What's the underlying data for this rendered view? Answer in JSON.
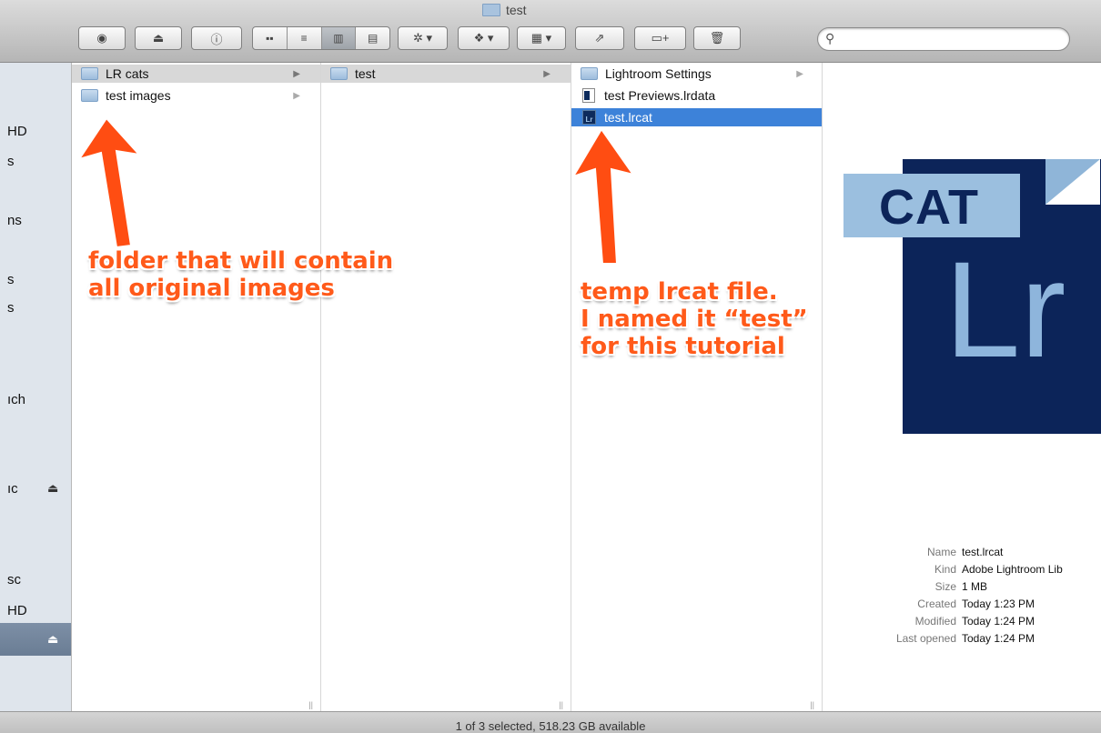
{
  "window": {
    "title": "test"
  },
  "toolbar": {
    "view_buttons": [
      "▪▪",
      "≡",
      "▥",
      "▤"
    ],
    "search": {
      "placeholder": ""
    }
  },
  "sidebar": {
    "items": [
      {
        "label": "HD",
        "eject": false
      },
      {
        "label": "s",
        "eject": false
      },
      {
        "label": "ns",
        "eject": false
      },
      {
        "label": "s",
        "eject": false
      },
      {
        "label": "s",
        "eject": false
      },
      {
        "label": "ıch",
        "eject": false
      },
      {
        "label": "ıc",
        "eject": true
      },
      {
        "label": "sc",
        "eject": false
      },
      {
        "label": "HD",
        "eject": false
      }
    ]
  },
  "columns": [
    {
      "items": [
        {
          "name": "LR cats",
          "icon": "folder-icon",
          "state": "gray",
          "has_children": true
        },
        {
          "name": "test images",
          "icon": "folder-icon",
          "state": "none",
          "has_children": true
        }
      ]
    },
    {
      "items": [
        {
          "name": "test",
          "icon": "folder-icon",
          "state": "gray",
          "has_children": true
        }
      ]
    },
    {
      "items": [
        {
          "name": "Lightroom Settings",
          "icon": "folder-icon",
          "state": "none",
          "has_children": true
        },
        {
          "name": "test Previews.lrdata",
          "icon": "document-icon",
          "state": "none",
          "has_children": false
        },
        {
          "name": "test.lrcat",
          "icon": "lrcat-icon",
          "state": "selected",
          "has_children": false
        }
      ]
    }
  ],
  "preview": {
    "icon_text": {
      "cat": "CAT",
      "lr": "Lr"
    },
    "info": [
      {
        "key": "Name",
        "value": "test.lrcat"
      },
      {
        "key": "Kind",
        "value": "Adobe Lightroom Lib"
      },
      {
        "key": "Size",
        "value": "1 MB"
      },
      {
        "key": "Created",
        "value": "Today 1:23 PM"
      },
      {
        "key": "Modified",
        "value": "Today 1:24 PM"
      },
      {
        "key": "Last opened",
        "value": "Today 1:24 PM"
      }
    ]
  },
  "status": {
    "text": "1 of 3 selected, 518.23 GB available"
  },
  "annotations": {
    "left": [
      "folder that will contain",
      "all original images"
    ],
    "right": [
      "temp lrcat file.",
      "I named it “test”",
      "for this tutorial"
    ]
  },
  "colors": {
    "annotation": "#ff5a1a",
    "selection": "#3d82d9",
    "lr_dark": "#0c2459",
    "lr_light": "#9bbfdf"
  }
}
